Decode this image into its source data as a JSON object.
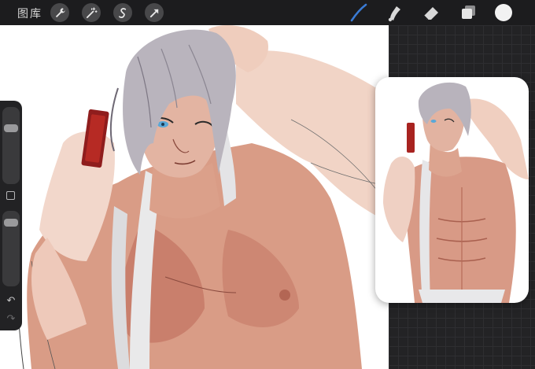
{
  "toolbar": {
    "gallery_label": "图库",
    "left_tools": [
      {
        "icon": "wrench-icon"
      },
      {
        "icon": "magic-wand-icon"
      },
      {
        "icon": "selection-icon"
      },
      {
        "icon": "transform-arrow-icon"
      }
    ],
    "right_tools": [
      {
        "icon": "brush-icon",
        "active": true
      },
      {
        "icon": "smudge-icon"
      },
      {
        "icon": "eraser-icon"
      },
      {
        "icon": "layers-icon"
      },
      {
        "icon": "color-swatch-icon"
      }
    ]
  },
  "sidebar": {
    "brush_size": 0.75,
    "opacity": 0.88,
    "undo_icon": "↶",
    "redo_icon": "↷"
  },
  "colors": {
    "accent": "#3a7bd5",
    "toolbar_bg": "#1c1c1e",
    "canvas_bg": "#ffffff",
    "current_color": "#f2f2f2"
  }
}
